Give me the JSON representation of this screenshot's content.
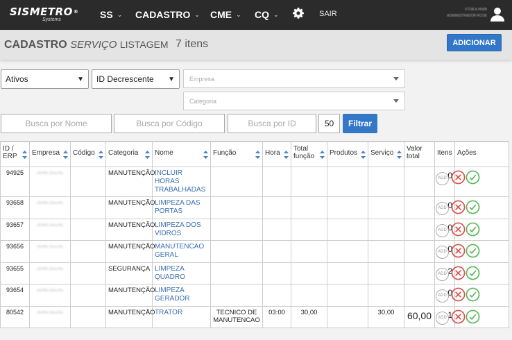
{
  "nav": {
    "brand": "SISMETRO",
    "brand_reg": "®",
    "brand_sub": "Systems",
    "items": [
      {
        "label": "SS"
      },
      {
        "label": "CADASTRO"
      },
      {
        "label": "CME"
      },
      {
        "label": "CQ"
      }
    ],
    "logout": "SAIR",
    "user_line1": "XTOB A HIWB",
    "user_line2": "ADMINISTRADOR RCOE"
  },
  "header": {
    "title_bold": "CADASTRO",
    "title_italic": "SERVIÇO",
    "title_rest": "LISTAGEM",
    "count": "7 itens",
    "add_button": "ADICIONAR"
  },
  "filters": {
    "status_value": "Ativos",
    "order_value": "ID Decrescente",
    "empresa_placeholder": "Empresa",
    "categoria_placeholder": "Categoria",
    "name_placeholder": "Busca por Nome",
    "code_placeholder": "Busca por Código",
    "id_placeholder": "Busca por ID",
    "page_size": "50",
    "filter_button": "Filtrar"
  },
  "table": {
    "headers": {
      "id": "ID / ERP",
      "empresa": "Empresa",
      "codigo": "Código",
      "categoria": "Categoria",
      "nome": "Nome",
      "funcao": "Função",
      "hora": "Hora",
      "total_funcao": "Total função",
      "produtos": "Produtos",
      "servico": "Serviço",
      "valor_total": "Valor total",
      "itens": "Itens",
      "acoes": "Ações"
    },
    "add_label": "ADD",
    "rows": [
      {
        "id": "94925",
        "empresa": "JOHN DEERE",
        "categoria": "MANUTENÇÃO",
        "nome": "INCLUIR HORAS TRABALHADAS",
        "funcao": "",
        "hora": "",
        "total_funcao": "",
        "servico": "",
        "valor": "",
        "itens": "0"
      },
      {
        "id": "93658",
        "empresa": "JOHN DEERE",
        "categoria": "MANUTENÇÃO",
        "nome": "LIMPEZA DAS PORTAS",
        "funcao": "",
        "hora": "",
        "total_funcao": "",
        "servico": "",
        "valor": "",
        "itens": "0"
      },
      {
        "id": "93657",
        "empresa": "JOHN DEERE",
        "categoria": "MANUTENÇÃO",
        "nome": "LIMPEZA DOS VIDROS",
        "funcao": "",
        "hora": "",
        "total_funcao": "",
        "servico": "",
        "valor": "",
        "itens": "0"
      },
      {
        "id": "93656",
        "empresa": "JOHN DEERE",
        "categoria": "MANUTENÇÃO",
        "nome": "MANUTENCAO GERAL",
        "funcao": "",
        "hora": "",
        "total_funcao": "",
        "servico": "",
        "valor": "",
        "itens": "0"
      },
      {
        "id": "93655",
        "empresa": "JOHN DEERE",
        "categoria": "SEGURANÇA",
        "nome": "LIMPEZA QUADRO",
        "funcao": "",
        "hora": "",
        "total_funcao": "",
        "servico": "",
        "valor": "",
        "itens": "2"
      },
      {
        "id": "93654",
        "empresa": "JOHN DEERE",
        "categoria": "MANUTENÇÃO",
        "nome": "LIMPEZA GERADOR",
        "funcao": "",
        "hora": "",
        "total_funcao": "",
        "servico": "",
        "valor": "",
        "itens": "0"
      },
      {
        "id": "80542",
        "empresa": "JOHN DEERE",
        "categoria": "MANUTENÇÃO",
        "nome": "TRATOR",
        "funcao": "TECNICO DE MANUTENCAO",
        "hora": "03:00",
        "total_funcao": "30,00",
        "servico": "30,00",
        "valor": "60,00",
        "itens": "1"
      }
    ]
  }
}
